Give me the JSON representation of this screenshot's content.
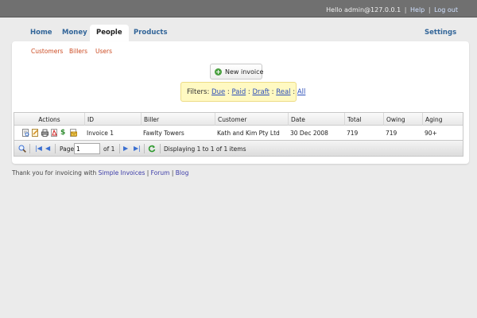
{
  "topbar": {
    "greeting": "Hello admin@127.0.0.1",
    "separator": "|",
    "help": "Help",
    "logout": "Log out"
  },
  "nav": {
    "tabs": [
      {
        "label": "Home"
      },
      {
        "label": "Money"
      },
      {
        "label": "People",
        "active": true
      },
      {
        "label": "Products"
      }
    ],
    "settings": "Settings"
  },
  "subnav": {
    "items": [
      {
        "label": "Customers"
      },
      {
        "label": "Billers"
      },
      {
        "label": "Users"
      }
    ]
  },
  "new_invoice": {
    "label": "New invoice",
    "icon": "plus-circle-icon"
  },
  "filters": {
    "prefix": "Filters:",
    "sep": ":",
    "items": [
      {
        "label": "Due"
      },
      {
        "label": "Paid"
      },
      {
        "label": "Draft"
      },
      {
        "label": "Real"
      },
      {
        "label": "All"
      }
    ]
  },
  "grid": {
    "columns": [
      "Actions",
      "ID",
      "Biller",
      "Customer",
      "Date",
      "Total",
      "Owing",
      "Aging"
    ],
    "rows": [
      {
        "id": "Invoice 1",
        "biller": "Fawlty Towers",
        "customer": "Kath and Kim Pty Ltd",
        "date": "30 Dec 2008",
        "total": "719",
        "owing": "719",
        "aging": "90+",
        "action_icons": [
          "view-icon",
          "edit-icon",
          "print-icon",
          "pdf-icon",
          "payment-icon",
          "email-icon"
        ]
      }
    ],
    "pager": {
      "page_label": "Page",
      "page_value": "1",
      "of_label": "of 1",
      "status": "Displaying 1 to 1 of 1 items"
    }
  },
  "footer": {
    "prefix": "Thank you for invoicing with",
    "app_link": "Simple Invoices",
    "sep": "|",
    "forum": "Forum",
    "blog": "Blog"
  },
  "colors": {
    "topbar": "#707070",
    "nav_text": "#336699",
    "subnav_text": "#cc4b22",
    "filters_bg": "#fff9c2",
    "link": "#2a4db8"
  }
}
